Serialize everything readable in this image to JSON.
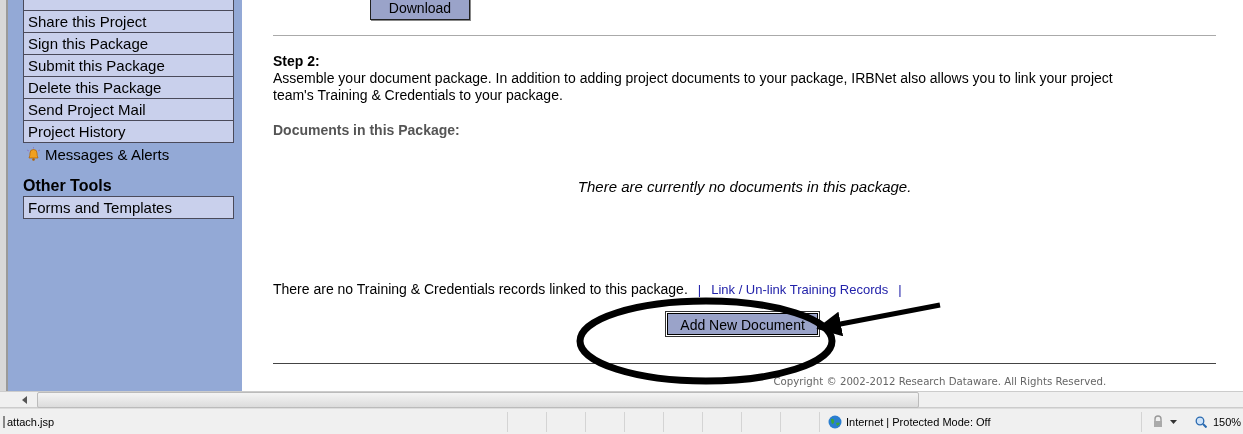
{
  "sidebar": {
    "items": [
      {
        "label": "Share this Project"
      },
      {
        "label": "Sign this Package"
      },
      {
        "label": "Submit this Package"
      },
      {
        "label": "Delete this Package"
      },
      {
        "label": "Send Project Mail"
      },
      {
        "label": "Project History"
      }
    ],
    "alerts": "Messages & Alerts",
    "other_tools": {
      "heading": "Other Tools",
      "items": [
        {
          "label": "Forms and Templates"
        }
      ]
    }
  },
  "main": {
    "download_button": "Download",
    "step_title": "Step 2:",
    "step_text": "Assemble your document package. In addition to adding project documents to your package, IRBNet also allows you to link your project team's Training & Credentials to your package.",
    "documents_heading": "Documents in this Package:",
    "empty_message": "There are currently no documents in this package.",
    "training_text": "There are no Training & Credentials records linked to this package.",
    "training_links": {
      "before": "|",
      "link": "Link / Un-link Training Records",
      "after": "|"
    },
    "add_button": "Add New Document",
    "copyright": "Copyright © 2002-2012 Research Dataware. All Rights Reserved."
  },
  "status_bar": {
    "url": "attach.jsp",
    "zone": "Internet | Protected Mode: Off",
    "zoom": "150%"
  }
}
